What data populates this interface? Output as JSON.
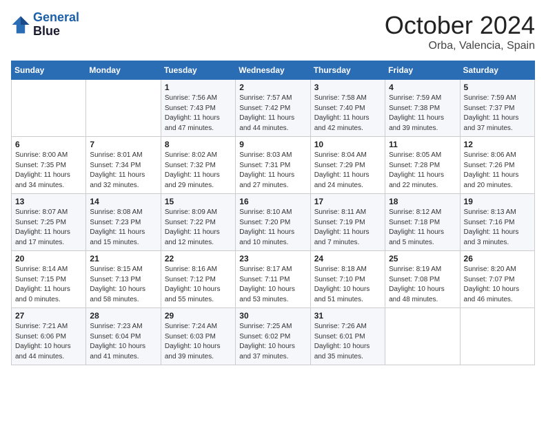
{
  "header": {
    "logo_line1": "General",
    "logo_line2": "Blue",
    "month": "October 2024",
    "location": "Orba, Valencia, Spain"
  },
  "weekdays": [
    "Sunday",
    "Monday",
    "Tuesday",
    "Wednesday",
    "Thursday",
    "Friday",
    "Saturday"
  ],
  "weeks": [
    [
      {
        "day": "",
        "content": ""
      },
      {
        "day": "",
        "content": ""
      },
      {
        "day": "1",
        "content": "Sunrise: 7:56 AM\nSunset: 7:43 PM\nDaylight: 11 hours\nand 47 minutes."
      },
      {
        "day": "2",
        "content": "Sunrise: 7:57 AM\nSunset: 7:42 PM\nDaylight: 11 hours\nand 44 minutes."
      },
      {
        "day": "3",
        "content": "Sunrise: 7:58 AM\nSunset: 7:40 PM\nDaylight: 11 hours\nand 42 minutes."
      },
      {
        "day": "4",
        "content": "Sunrise: 7:59 AM\nSunset: 7:38 PM\nDaylight: 11 hours\nand 39 minutes."
      },
      {
        "day": "5",
        "content": "Sunrise: 7:59 AM\nSunset: 7:37 PM\nDaylight: 11 hours\nand 37 minutes."
      }
    ],
    [
      {
        "day": "6",
        "content": "Sunrise: 8:00 AM\nSunset: 7:35 PM\nDaylight: 11 hours\nand 34 minutes."
      },
      {
        "day": "7",
        "content": "Sunrise: 8:01 AM\nSunset: 7:34 PM\nDaylight: 11 hours\nand 32 minutes."
      },
      {
        "day": "8",
        "content": "Sunrise: 8:02 AM\nSunset: 7:32 PM\nDaylight: 11 hours\nand 29 minutes."
      },
      {
        "day": "9",
        "content": "Sunrise: 8:03 AM\nSunset: 7:31 PM\nDaylight: 11 hours\nand 27 minutes."
      },
      {
        "day": "10",
        "content": "Sunrise: 8:04 AM\nSunset: 7:29 PM\nDaylight: 11 hours\nand 24 minutes."
      },
      {
        "day": "11",
        "content": "Sunrise: 8:05 AM\nSunset: 7:28 PM\nDaylight: 11 hours\nand 22 minutes."
      },
      {
        "day": "12",
        "content": "Sunrise: 8:06 AM\nSunset: 7:26 PM\nDaylight: 11 hours\nand 20 minutes."
      }
    ],
    [
      {
        "day": "13",
        "content": "Sunrise: 8:07 AM\nSunset: 7:25 PM\nDaylight: 11 hours\nand 17 minutes."
      },
      {
        "day": "14",
        "content": "Sunrise: 8:08 AM\nSunset: 7:23 PM\nDaylight: 11 hours\nand 15 minutes."
      },
      {
        "day": "15",
        "content": "Sunrise: 8:09 AM\nSunset: 7:22 PM\nDaylight: 11 hours\nand 12 minutes."
      },
      {
        "day": "16",
        "content": "Sunrise: 8:10 AM\nSunset: 7:20 PM\nDaylight: 11 hours\nand 10 minutes."
      },
      {
        "day": "17",
        "content": "Sunrise: 8:11 AM\nSunset: 7:19 PM\nDaylight: 11 hours\nand 7 minutes."
      },
      {
        "day": "18",
        "content": "Sunrise: 8:12 AM\nSunset: 7:18 PM\nDaylight: 11 hours\nand 5 minutes."
      },
      {
        "day": "19",
        "content": "Sunrise: 8:13 AM\nSunset: 7:16 PM\nDaylight: 11 hours\nand 3 minutes."
      }
    ],
    [
      {
        "day": "20",
        "content": "Sunrise: 8:14 AM\nSunset: 7:15 PM\nDaylight: 11 hours\nand 0 minutes."
      },
      {
        "day": "21",
        "content": "Sunrise: 8:15 AM\nSunset: 7:13 PM\nDaylight: 10 hours\nand 58 minutes."
      },
      {
        "day": "22",
        "content": "Sunrise: 8:16 AM\nSunset: 7:12 PM\nDaylight: 10 hours\nand 55 minutes."
      },
      {
        "day": "23",
        "content": "Sunrise: 8:17 AM\nSunset: 7:11 PM\nDaylight: 10 hours\nand 53 minutes."
      },
      {
        "day": "24",
        "content": "Sunrise: 8:18 AM\nSunset: 7:10 PM\nDaylight: 10 hours\nand 51 minutes."
      },
      {
        "day": "25",
        "content": "Sunrise: 8:19 AM\nSunset: 7:08 PM\nDaylight: 10 hours\nand 48 minutes."
      },
      {
        "day": "26",
        "content": "Sunrise: 8:20 AM\nSunset: 7:07 PM\nDaylight: 10 hours\nand 46 minutes."
      }
    ],
    [
      {
        "day": "27",
        "content": "Sunrise: 7:21 AM\nSunset: 6:06 PM\nDaylight: 10 hours\nand 44 minutes."
      },
      {
        "day": "28",
        "content": "Sunrise: 7:23 AM\nSunset: 6:04 PM\nDaylight: 10 hours\nand 41 minutes."
      },
      {
        "day": "29",
        "content": "Sunrise: 7:24 AM\nSunset: 6:03 PM\nDaylight: 10 hours\nand 39 minutes."
      },
      {
        "day": "30",
        "content": "Sunrise: 7:25 AM\nSunset: 6:02 PM\nDaylight: 10 hours\nand 37 minutes."
      },
      {
        "day": "31",
        "content": "Sunrise: 7:26 AM\nSunset: 6:01 PM\nDaylight: 10 hours\nand 35 minutes."
      },
      {
        "day": "",
        "content": ""
      },
      {
        "day": "",
        "content": ""
      }
    ]
  ]
}
